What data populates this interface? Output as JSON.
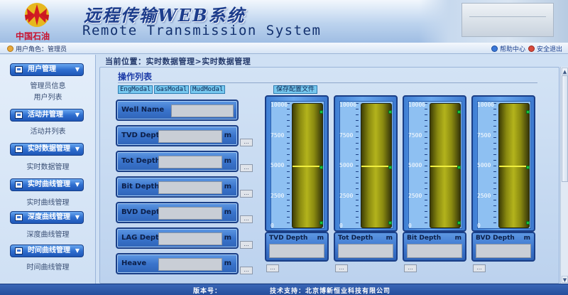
{
  "header": {
    "brand": "中国石油",
    "title_cn": "远程传输WEB系统",
    "title_en": "Remote Transmission System"
  },
  "topbar": {
    "user_role": "用户角色：管理员",
    "help": "帮助中心",
    "logout": "安全退出"
  },
  "breadcrumb": "当前位置：实时数据管理>实时数据管理",
  "sidebar": {
    "groups": [
      {
        "label": "用户管理",
        "subs": [
          "管理员信息",
          "用户列表"
        ]
      },
      {
        "label": "活动井管理",
        "subs": [
          "活动井列表"
        ]
      },
      {
        "label": "实时数据管理",
        "subs": [
          "实时数据管理"
        ]
      },
      {
        "label": "实时曲线管理",
        "subs": [
          "实时曲线管理"
        ]
      },
      {
        "label": "深度曲线管理",
        "subs": [
          "深度曲线管理"
        ]
      },
      {
        "label": "时间曲线管理",
        "subs": [
          "时间曲线管理"
        ]
      }
    ]
  },
  "panel": {
    "title": "操作列表",
    "tabs": [
      "EngModal",
      "GasModal",
      "MudModal"
    ],
    "save_label": "保存配置文件",
    "fields": [
      {
        "label": "Well Name",
        "unit": ""
      },
      {
        "label": "TVD Depth",
        "unit": "m"
      },
      {
        "label": "Tot Depth",
        "unit": "m"
      },
      {
        "label": "Bit Depth",
        "unit": "m"
      },
      {
        "label": "BVD Depth",
        "unit": "m"
      },
      {
        "label": "LAG Depth",
        "unit": "m"
      },
      {
        "label": "Heave",
        "unit": "m"
      }
    ],
    "more_label": "...",
    "gauges": [
      {
        "label": "TVD Depth",
        "unit": "m",
        "level": 0.5
      },
      {
        "label": "Tot Depth",
        "unit": "m",
        "level": 0.5
      },
      {
        "label": "Bit Depth",
        "unit": "m",
        "level": 0.5
      },
      {
        "label": "BVD Depth",
        "unit": "m",
        "level": 0.5
      }
    ],
    "gauge_scale": [
      "10000",
      "7500",
      "5000",
      "2500",
      "0"
    ]
  },
  "footer": {
    "version": "版本号：",
    "support": "技术支持：北京博新恒业科技有限公司"
  },
  "colors": {
    "menu_button": "#2f6fd0",
    "tube": "#8a8a10",
    "marker": "#f1f040",
    "indicator": "#17c43d"
  },
  "icons": {
    "logo": "petrochina-logo",
    "menu": "folder-icon",
    "help": "help-icon",
    "logout": "logout-icon"
  }
}
